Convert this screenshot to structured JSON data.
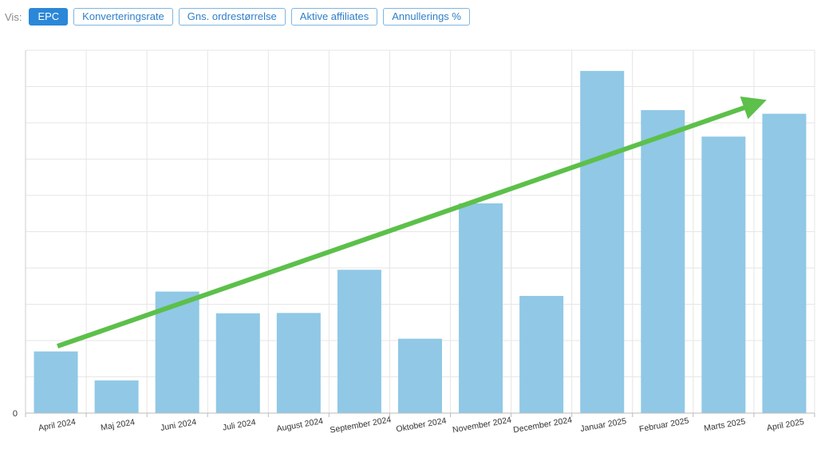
{
  "toolbar": {
    "label": "Vis:",
    "tabs": [
      {
        "label": "EPC",
        "active": true
      },
      {
        "label": "Konverteringsrate",
        "active": false
      },
      {
        "label": "Gns. ordrestørrelse",
        "active": false
      },
      {
        "label": "Aktive affiliates",
        "active": false
      },
      {
        "label": "Annullerings %",
        "active": false
      }
    ]
  },
  "chart_data": {
    "type": "bar",
    "categories": [
      "April 2024",
      "Maj 2024",
      "Juni 2024",
      "Juli 2024",
      "August 2024",
      "September 2024",
      "Oktober 2024",
      "November 2024",
      "December 2024",
      "Januar 2025",
      "Februar 2025",
      "Marts 2025",
      "April 2025"
    ],
    "values": [
      17,
      9,
      33.5,
      27.5,
      27.6,
      39.5,
      20.5,
      57.8,
      32.3,
      94.3,
      83.5,
      76.2,
      82.5
    ],
    "y_tick_labels": [
      "0"
    ],
    "ylim": [
      0,
      100
    ],
    "grid": true,
    "bar_color": "#90c8e6",
    "trend_arrow": {
      "from": {
        "category": "April 2024",
        "value": 18
      },
      "to": {
        "category": "April 2025",
        "value": 84
      },
      "color": "#5cc04a"
    }
  }
}
